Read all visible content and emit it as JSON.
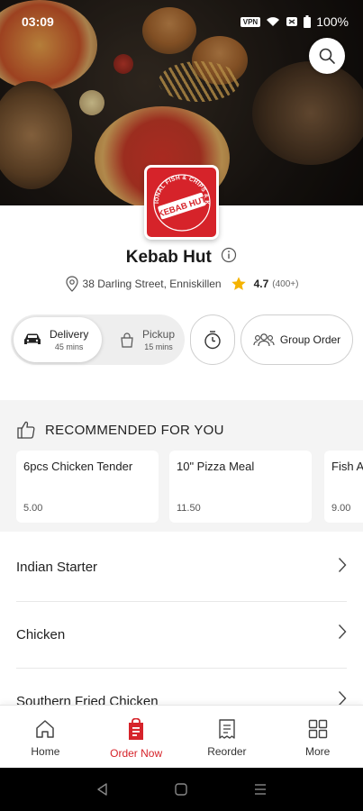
{
  "status_bar": {
    "time": "03:09",
    "vpn": "VPN",
    "battery": "100%"
  },
  "hero": {
    "logo_text_top": "TRADITIONAL FISH & CHIPS & KEBABS",
    "logo_text_center": "KEBAB HUT"
  },
  "restaurant": {
    "name": "Kebab Hut",
    "address": "38 Darling Street, Enniskillen",
    "rating": "4.7",
    "rating_count": "(400+)"
  },
  "order_modes": {
    "delivery": {
      "label": "Delivery",
      "time": "45 mins"
    },
    "pickup": {
      "label": "Pickup",
      "time": "15 mins"
    },
    "group_order_label": "Group Order"
  },
  "recommended": {
    "heading": "RECOMMENDED FOR YOU",
    "items": [
      {
        "name": "6pcs Chicken Tender",
        "price": "5.00"
      },
      {
        "name": "10\" Pizza Meal",
        "price": "11.50"
      },
      {
        "name": "Fish A",
        "price": "9.00"
      }
    ]
  },
  "categories": [
    {
      "name": "Indian Starter"
    },
    {
      "name": "Chicken"
    },
    {
      "name": "Southern Fried Chicken"
    }
  ],
  "bottom_nav": [
    {
      "label": "Home",
      "icon": "home-icon"
    },
    {
      "label": "Order Now",
      "icon": "order-bag-icon",
      "active": true
    },
    {
      "label": "Reorder",
      "icon": "receipt-icon"
    },
    {
      "label": "More",
      "icon": "grid-icon"
    }
  ],
  "colors": {
    "brand_red": "#d6232a",
    "star": "#f5b301"
  }
}
